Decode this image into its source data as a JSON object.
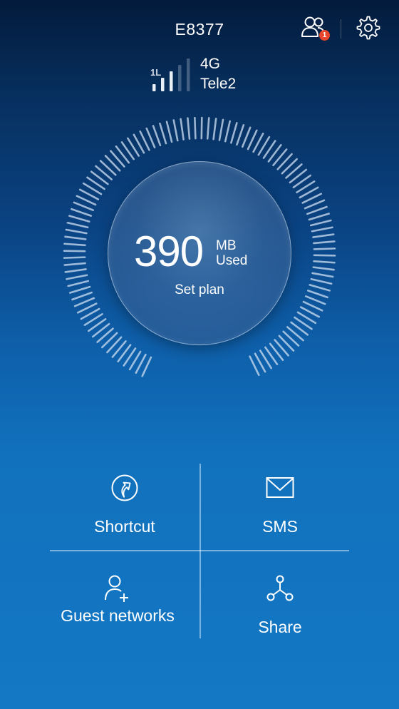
{
  "header": {
    "device_name": "E8377",
    "notification_count": "1",
    "users_icon": "users-icon",
    "settings_icon": "gear-icon"
  },
  "status": {
    "network_type": "4G",
    "operator": "Tele2",
    "signal_label": "1L",
    "signal_bars_active": 3,
    "signal_bars_total": 5
  },
  "usage": {
    "value": "390",
    "unit": "MB",
    "label": "Used",
    "action": "Set plan"
  },
  "tiles": [
    {
      "label": "Shortcut",
      "icon": "shortcut-arrow-icon"
    },
    {
      "label": "SMS",
      "icon": "envelope-icon"
    },
    {
      "label": "Guest networks",
      "icon": "add-user-icon"
    },
    {
      "label": "Share",
      "icon": "share-icon"
    }
  ],
  "colors": {
    "badge": "#e8452c",
    "background_top": "#031b3c",
    "background_bottom": "#1478c4"
  }
}
